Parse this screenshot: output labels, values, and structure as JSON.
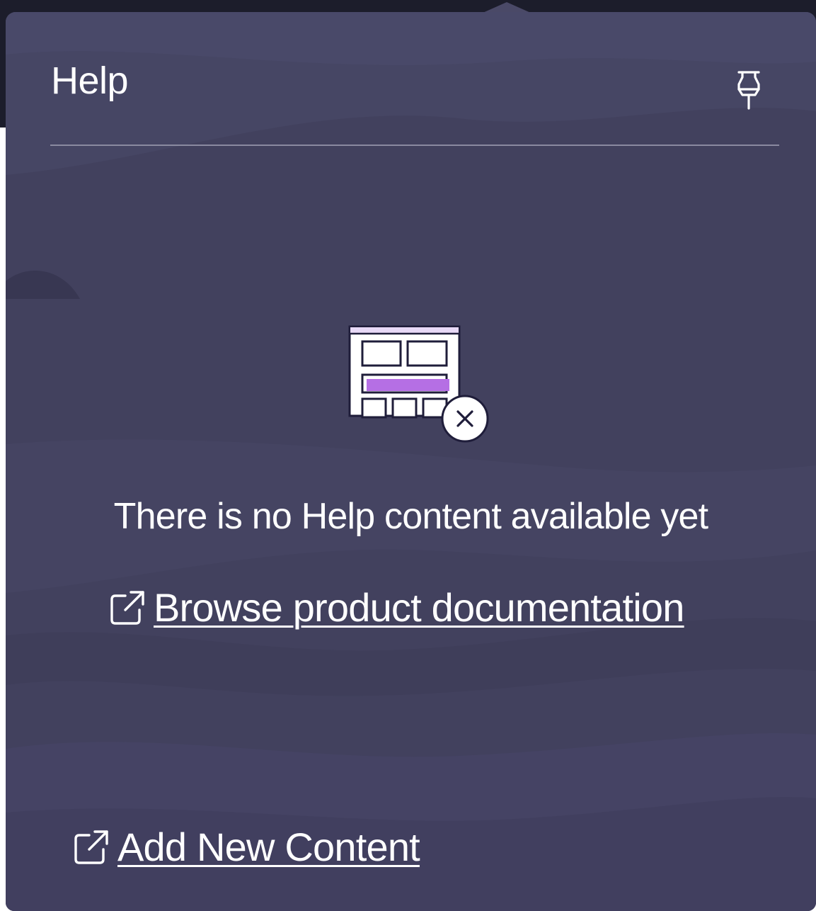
{
  "help_panel": {
    "title": "Help",
    "pin_icon": "pin-icon",
    "empty_state": {
      "illustration": "empty-layout-illustration",
      "message": "There is no Help content available yet"
    },
    "links": {
      "browse_docs_label": "Browse product documentation",
      "browse_docs_icon": "external-link-icon",
      "add_content_label": "Add New Content",
      "add_content_icon": "external-link-icon"
    }
  },
  "colors": {
    "panel_background": "#42415e",
    "text": "#ffffff",
    "illustration_accent": "#b56fe4",
    "illustration_outline": "#1f1d3a"
  }
}
